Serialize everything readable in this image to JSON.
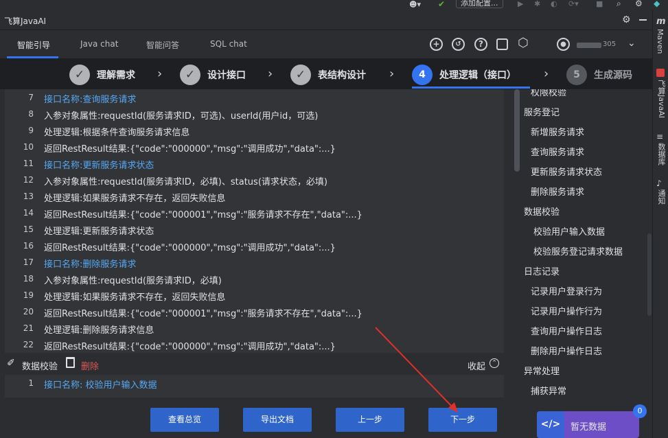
{
  "top_strip": {
    "add_config": "添加配置..."
  },
  "window_title": "飞算JavaAI",
  "tabs": [
    {
      "label": "智能引导"
    },
    {
      "label": "Java chat"
    },
    {
      "label": "智能问答"
    },
    {
      "label": "SQL chat"
    }
  ],
  "user": {
    "name_suffix": "305"
  },
  "steps": [
    {
      "label": "理解需求",
      "state": "done",
      "mark": "✓"
    },
    {
      "label": "设计接口",
      "state": "done",
      "mark": "✓"
    },
    {
      "label": "表结构设计",
      "state": "done",
      "mark": "✓"
    },
    {
      "label": "处理逻辑（接口）",
      "state": "active",
      "mark": "4"
    },
    {
      "label": "生成源码",
      "state": "pending",
      "mark": "5"
    }
  ],
  "code_lines": [
    {
      "num": "7",
      "text": "接口名称:查询服务请求",
      "head": true
    },
    {
      "num": "8",
      "text": "入参对象属性:requestId(服务请求ID，可选)、userId(用户id，可选)",
      "head": false
    },
    {
      "num": "9",
      "text": "处理逻辑:根据条件查询服务请求信息",
      "head": false
    },
    {
      "num": "10",
      "text": "返回RestResult结果:{\"code\":\"000000\",\"msg\":\"调用成功\",\"data\":...}",
      "head": false
    },
    {
      "num": "11",
      "text": "接口名称:更新服务请求状态",
      "head": true
    },
    {
      "num": "12",
      "text": "入参对象属性:requestId(服务请求ID，必填)、status(请求状态，必填)",
      "head": false
    },
    {
      "num": "13",
      "text": "处理逻辑:如果服务请求不存在，返回失败信息",
      "head": false
    },
    {
      "num": "14",
      "text": "返回RestResult结果:{\"code\":\"000001\",\"msg\":\"服务请求不存在\",\"data\":...}",
      "head": false
    },
    {
      "num": "15",
      "text": "处理逻辑:更新服务请求状态",
      "head": false
    },
    {
      "num": "16",
      "text": "返回RestResult结果:{\"code\":\"000000\",\"msg\":\"调用成功\",\"data\":...}",
      "head": false
    },
    {
      "num": "17",
      "text": "接口名称:删除服务请求",
      "head": true
    },
    {
      "num": "18",
      "text": "入参对象属性:requestId(服务请求ID，必填)",
      "head": false
    },
    {
      "num": "19",
      "text": "处理逻辑:如果服务请求不存在，返回失败信息",
      "head": false
    },
    {
      "num": "20",
      "text": "返回RestResult结果:{\"code\":\"000001\",\"msg\":\"服务请求不存在\",\"data\":...}",
      "head": false
    },
    {
      "num": "21",
      "text": "处理逻辑:删除服务请求信息",
      "head": false
    },
    {
      "num": "22",
      "text": "返回RestResult结果:{\"code\":\"000000\",\"msg\":\"调用成功\",\"data\":...}",
      "head": false
    }
  ],
  "action_row": {
    "validate": "数据校验",
    "delete": "删除",
    "collapse": "收起"
  },
  "code_lines2": [
    {
      "num": "1",
      "text": "接口名称: 校验用户输入数据",
      "head": true
    }
  ],
  "sidebar": [
    {
      "label": "权限校验",
      "indent": 1
    },
    {
      "label": "服务登记",
      "indent": 0
    },
    {
      "label": "新增服务请求",
      "indent": 1
    },
    {
      "label": "查询服务请求",
      "indent": 1
    },
    {
      "label": "更新服务请求状态",
      "indent": 1
    },
    {
      "label": "删除服务请求",
      "indent": 1
    },
    {
      "label": "数据校验",
      "indent": 0
    },
    {
      "label": "校验用户输入数据",
      "indent": 2
    },
    {
      "label": "校验服务登记请求数据",
      "indent": 2
    },
    {
      "label": "日志记录",
      "indent": 0
    },
    {
      "label": "记录用户登录行为",
      "indent": 1
    },
    {
      "label": "记录用户操作行为",
      "indent": 1
    },
    {
      "label": "查询用户操作日志",
      "indent": 1
    },
    {
      "label": "删除用户操作日志",
      "indent": 1
    },
    {
      "label": "异常处理",
      "indent": 0
    },
    {
      "label": "捕获异常",
      "indent": 1
    }
  ],
  "buttons": {
    "overview": "查看总览",
    "export": "导出文档",
    "prev": "上一步",
    "next": "下一步"
  },
  "tool_strip": {
    "maven": "Maven",
    "javaai": "飞算JavaAI",
    "database": "数据库",
    "notify": "通知"
  },
  "widget": {
    "label": "暂无数据",
    "badge": "0"
  },
  "colors": {
    "accent": "#3574f0",
    "link": "#57a8f5",
    "delete": "#e05555",
    "annotation": "#e0302a"
  }
}
